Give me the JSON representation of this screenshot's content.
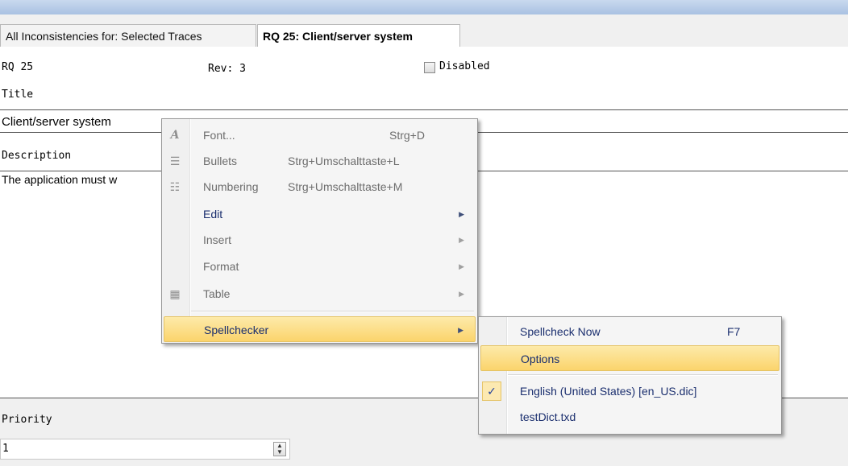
{
  "tabs": [
    {
      "label": "All Inconsistencies for: Selected Traces",
      "active": false
    },
    {
      "label": "RQ 25: Client/server system",
      "active": true
    }
  ],
  "form": {
    "id_label": "RQ 25",
    "rev_label": "Rev: 3",
    "disabled_label": "Disabled",
    "title_label": "Title",
    "title_value": "Client/server system",
    "description_label": "Description",
    "description_value": "The application must w",
    "priority_label": "Priority",
    "priority_value": "1"
  },
  "context_menu": {
    "items": [
      {
        "label": "Font...",
        "shortcut": "Strg+D",
        "icon": "font-icon",
        "enabled": false
      },
      {
        "label": "Bullets",
        "shortcut": "Strg+Umschalttaste+L",
        "icon": "bullets-icon",
        "enabled": false
      },
      {
        "label": "Numbering",
        "shortcut": "Strg+Umschalttaste+M",
        "icon": "numbering-icon",
        "enabled": false
      },
      {
        "label": "Edit",
        "submenu": true,
        "enabled": true
      },
      {
        "label": "Insert",
        "submenu": true,
        "enabled": false
      },
      {
        "label": "Format",
        "submenu": true,
        "enabled": false
      },
      {
        "label": "Table",
        "submenu": true,
        "icon": "table-icon",
        "enabled": false
      },
      {
        "label": "Spellchecker",
        "submenu": true,
        "enabled": true,
        "highlighted": true
      }
    ]
  },
  "spell_menu": {
    "items": [
      {
        "label": "Spellcheck Now",
        "shortcut": "F7"
      },
      {
        "label": "Options",
        "highlighted": true
      },
      {
        "label": "English (United States) [en_US.dic]",
        "checked": true
      },
      {
        "label": "testDict.txd"
      }
    ]
  },
  "colors": {
    "menu_highlight": "#fbd46c",
    "menu_text": "#1a2e6e",
    "titlebar": "#a9c1e2"
  }
}
